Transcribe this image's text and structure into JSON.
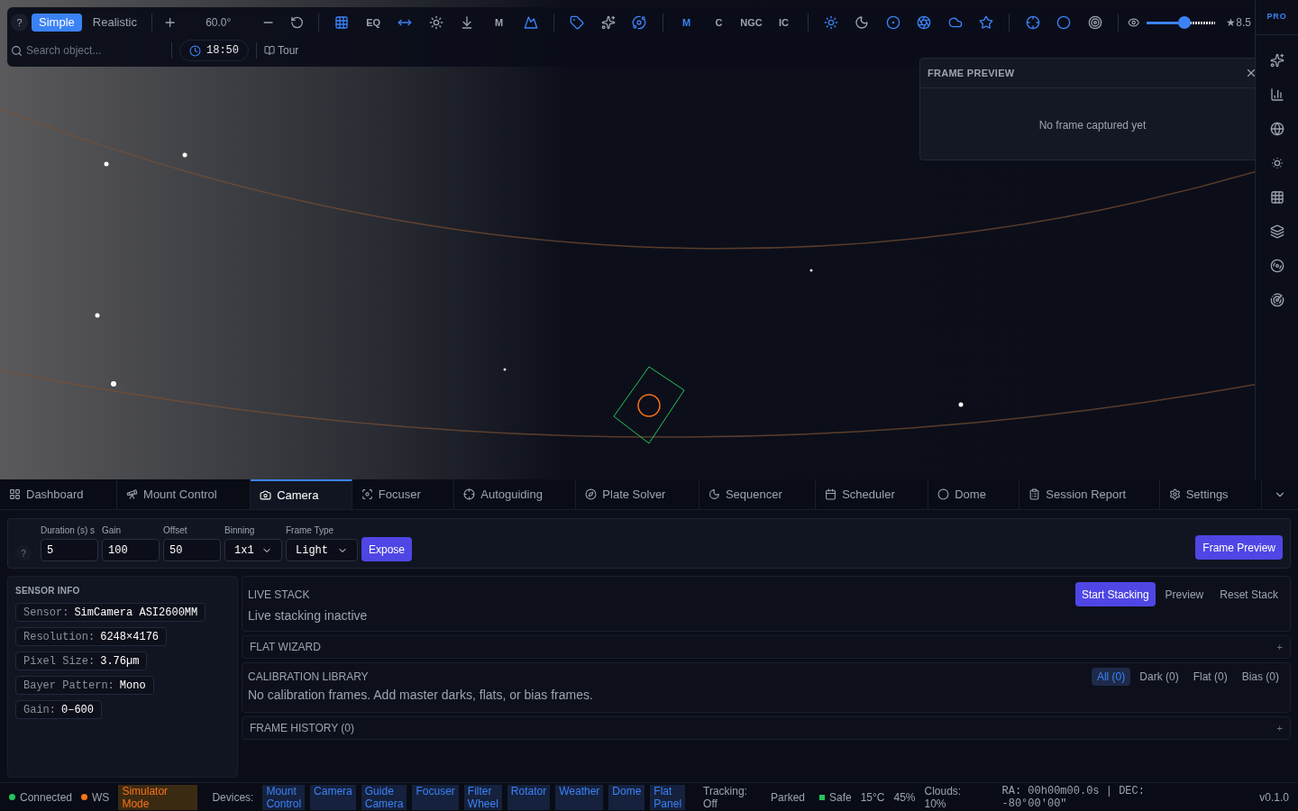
{
  "toolbar": {
    "help": "?",
    "modes": [
      {
        "label": "Simple",
        "selected": true
      },
      {
        "label": "Realistic",
        "selected": false
      }
    ],
    "fov": "60.0°",
    "groups": [
      [
        {
          "kind": "icon",
          "on": true
        },
        {
          "kind": "text",
          "label": "EQ",
          "on": false
        },
        {
          "kind": "icon",
          "on": true
        },
        {
          "kind": "icon",
          "on": false
        },
        {
          "kind": "icon",
          "on": false
        },
        {
          "kind": "text",
          "label": "M",
          "on": false
        },
        {
          "kind": "icon",
          "on": true
        }
      ],
      [
        {
          "kind": "icon",
          "on": true
        },
        {
          "kind": "icon",
          "on": false
        },
        {
          "kind": "icon",
          "on": true
        }
      ],
      [
        {
          "kind": "text",
          "label": "M",
          "on": true
        },
        {
          "kind": "text",
          "label": "C",
          "on": false
        },
        {
          "kind": "text",
          "label": "NGC",
          "on": false
        },
        {
          "kind": "text",
          "label": "IC",
          "on": false
        }
      ],
      [
        {
          "kind": "icon",
          "on": true
        },
        {
          "kind": "icon",
          "on": false
        },
        {
          "kind": "icon",
          "on": true
        },
        {
          "kind": "icon",
          "on": true
        },
        {
          "kind": "icon",
          "on": true
        },
        {
          "kind": "icon",
          "on": true
        }
      ],
      [
        {
          "kind": "icon",
          "on": true
        },
        {
          "kind": "icon",
          "on": true
        },
        {
          "kind": "icon",
          "on": false
        }
      ]
    ],
    "magnitude": {
      "level": 0.55,
      "reading": "★8.5"
    },
    "search": {
      "placeholder": "Search object..."
    },
    "time": "18:50",
    "tour": "Tour"
  },
  "badge": "PRO",
  "frame_preview": {
    "title": "FRAME PREVIEW",
    "message": "No frame captured yet"
  },
  "tabs": [
    {
      "label": "Dashboard",
      "selected": false
    },
    {
      "label": "Mount Control",
      "selected": false
    },
    {
      "label": "Camera",
      "selected": true
    },
    {
      "label": "Focuser",
      "selected": false
    },
    {
      "label": "Autoguiding",
      "selected": false
    },
    {
      "label": "Plate Solver",
      "selected": false
    },
    {
      "label": "Sequencer",
      "selected": false
    },
    {
      "label": "Scheduler",
      "selected": false
    },
    {
      "label": "Dome",
      "selected": false
    },
    {
      "label": "Session Report",
      "selected": false
    },
    {
      "label": "Settings",
      "selected": false
    }
  ],
  "camera": {
    "help": "?",
    "fields": [
      {
        "label": "Duration (s) s",
        "value": "5"
      },
      {
        "label": "Gain",
        "value": "100"
      },
      {
        "label": "Offset",
        "value": "50"
      }
    ],
    "selects": [
      {
        "label": "Binning",
        "value": "1x1"
      },
      {
        "label": "Frame Type",
        "value": "Light"
      }
    ],
    "expose": "Expose",
    "frame_preview": "Frame Preview"
  },
  "sensor_info": {
    "title": "SENSOR INFO",
    "rows": [
      {
        "label": "Sensor:",
        "value": "SimCamera ASI2600MM"
      },
      {
        "label": "Resolution:",
        "value": "6248×4176"
      },
      {
        "label": "Pixel Size:",
        "value": "3.76µm"
      },
      {
        "label": "Bayer Pattern:",
        "value": "Mono"
      },
      {
        "label": "Gain:",
        "value": "0–600"
      }
    ]
  },
  "live_stack": {
    "title": "LIVE STACK",
    "status": "Live stacking inactive",
    "buttons": [
      {
        "label": "Start Stacking",
        "kind": "primary"
      },
      {
        "label": "Preview",
        "kind": "plain"
      },
      {
        "label": "Reset Stack",
        "kind": "plain"
      }
    ]
  },
  "flat_wizard": {
    "title": "FLAT WIZARD",
    "toggle": "+"
  },
  "calibration": {
    "title": "CALIBRATION LIBRARY",
    "message": "No calibration frames. Add master darks, flats, or bias frames.",
    "filters": [
      {
        "label": "All (0)",
        "selected": true
      },
      {
        "label": "Dark (0)",
        "selected": false
      },
      {
        "label": "Flat (0)",
        "selected": false
      },
      {
        "label": "Bias (0)",
        "selected": false
      }
    ]
  },
  "frame_history": {
    "title": "FRAME HISTORY (0)",
    "toggle": "+"
  },
  "status_bar": {
    "indicators": [
      {
        "label": "Connected",
        "color": "#22c55e"
      },
      {
        "label": "WS",
        "color": "#f97316"
      }
    ],
    "mode": "Simulator Mode",
    "devices_label": "Devices:",
    "devices": [
      "Mount Control",
      "Camera",
      "Guide Camera",
      "Focuser",
      "Filter Wheel",
      "Rotator",
      "Weather",
      "Dome",
      "Flat Panel"
    ],
    "tracking": "Tracking: Off",
    "park": "Parked",
    "safety": {
      "label": "Safe",
      "color": "#22c55e"
    },
    "temperature": "15°C",
    "humidity": "45%",
    "clouds": "Clouds: 10%",
    "coordinates": "RA: 00h00m00.0s | DEC: -80°00'00\"",
    "version": "v0.1.0"
  }
}
